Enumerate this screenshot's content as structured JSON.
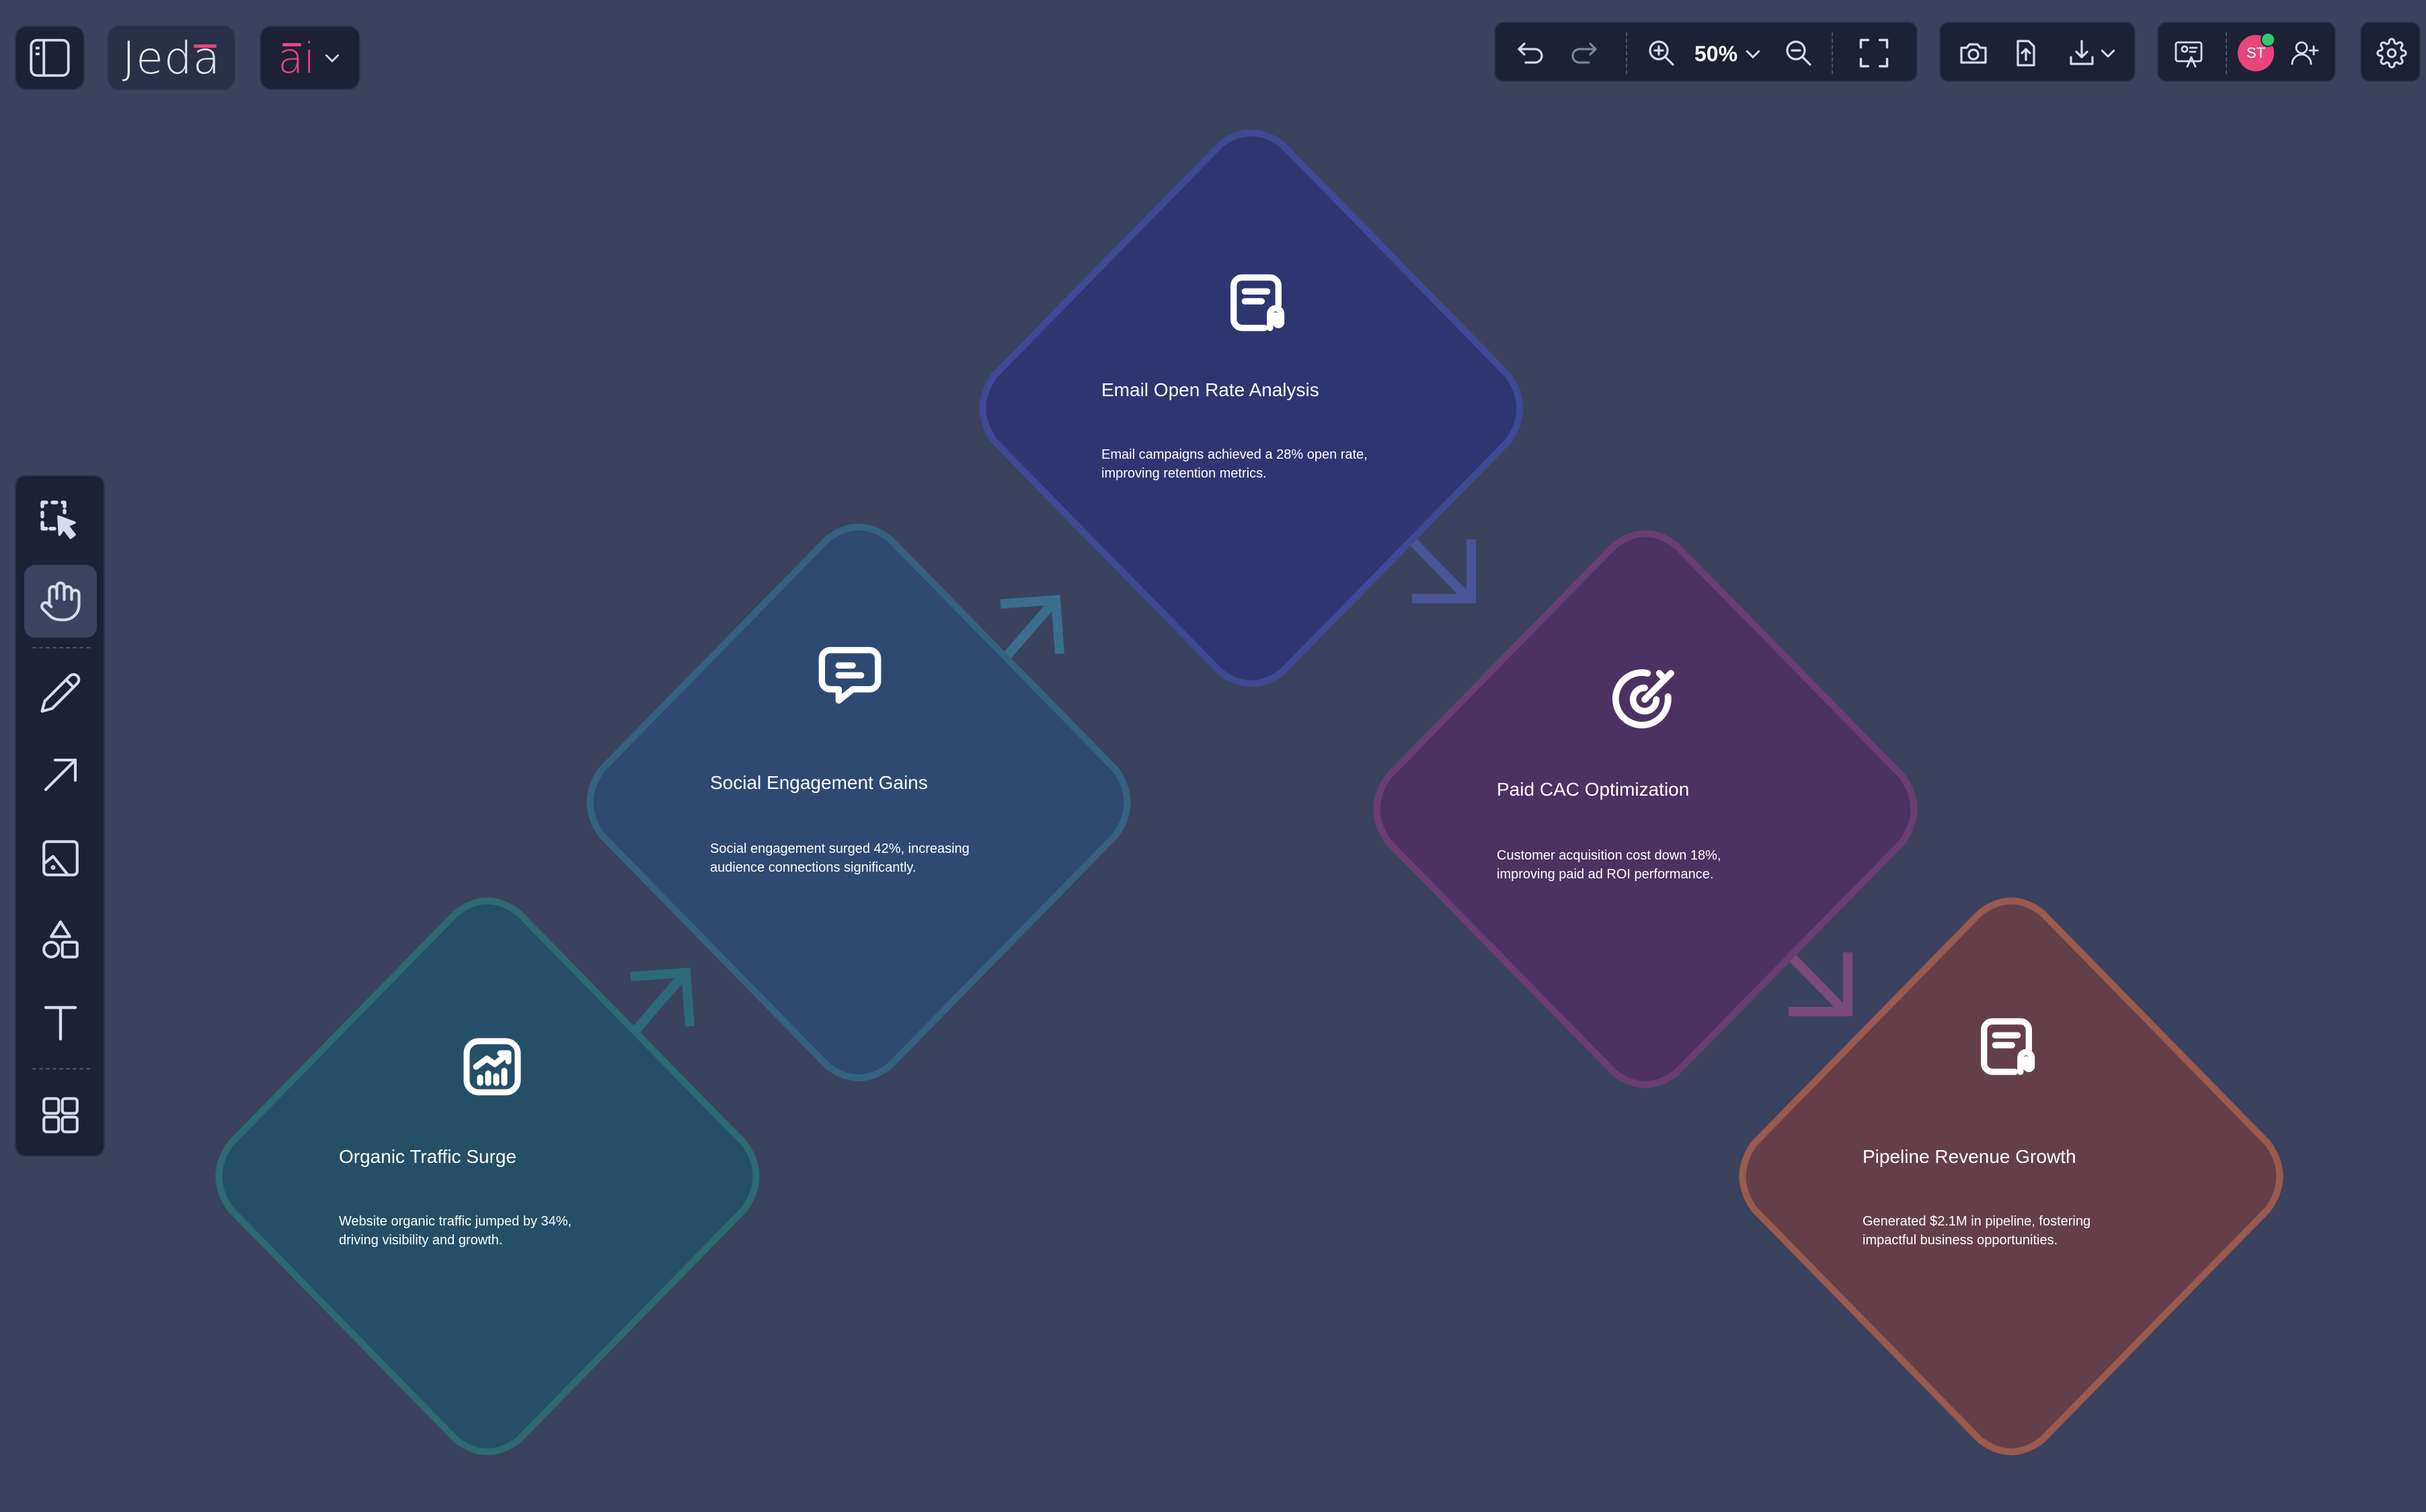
{
  "header": {
    "logo_text": "Jeda",
    "ai_label": "ai",
    "zoom_value": "50%",
    "avatar_initials": "ST"
  },
  "colors": {
    "canvas_bg": "#3a425e",
    "panel_bg": "#1c2135",
    "accent_pink": "#e8457c",
    "online_green": "#2ecc71"
  },
  "toolbar_icons": [
    "undo-icon",
    "redo-icon",
    "zoom-in-icon",
    "zoom-out-icon",
    "fit-screen-icon",
    "camera-icon",
    "share-icon",
    "download-icon",
    "present-icon",
    "add-user-icon",
    "gear-icon"
  ],
  "left_tools": [
    "select-tool",
    "hand-tool",
    "pen-tool",
    "arrow-tool",
    "image-tool",
    "shapes-tool",
    "text-tool",
    "templates-tool"
  ],
  "nodes": [
    {
      "title": "Organic Traffic Surge",
      "desc": [
        "Website organic traffic jumped by 34%,",
        "driving visibility and growth."
      ],
      "icon": "chart-icon",
      "color": "#244f66"
    },
    {
      "title": "Social Engagement Gains",
      "desc": [
        "Social engagement surged 42%, increasing",
        "audience connections significantly."
      ],
      "icon": "chat-icon",
      "color": "#2e4a72"
    },
    {
      "title": "Email Open Rate Analysis",
      "desc": [
        "Email campaigns achieved a 28% open rate,",
        "improving retention metrics."
      ],
      "icon": "document-icon",
      "color": "#2e3672"
    },
    {
      "title": "Paid CAC Optimization",
      "desc": [
        "Customer acquisition cost down 18%,",
        "improving paid ad ROI performance."
      ],
      "icon": "target-icon",
      "color": "#4b3262"
    },
    {
      "title": "Pipeline Revenue Growth",
      "desc": [
        "Generated $2.1M in pipeline, fostering",
        "impactful business opportunities."
      ],
      "icon": "document-icon",
      "color": "#643f4a"
    }
  ]
}
